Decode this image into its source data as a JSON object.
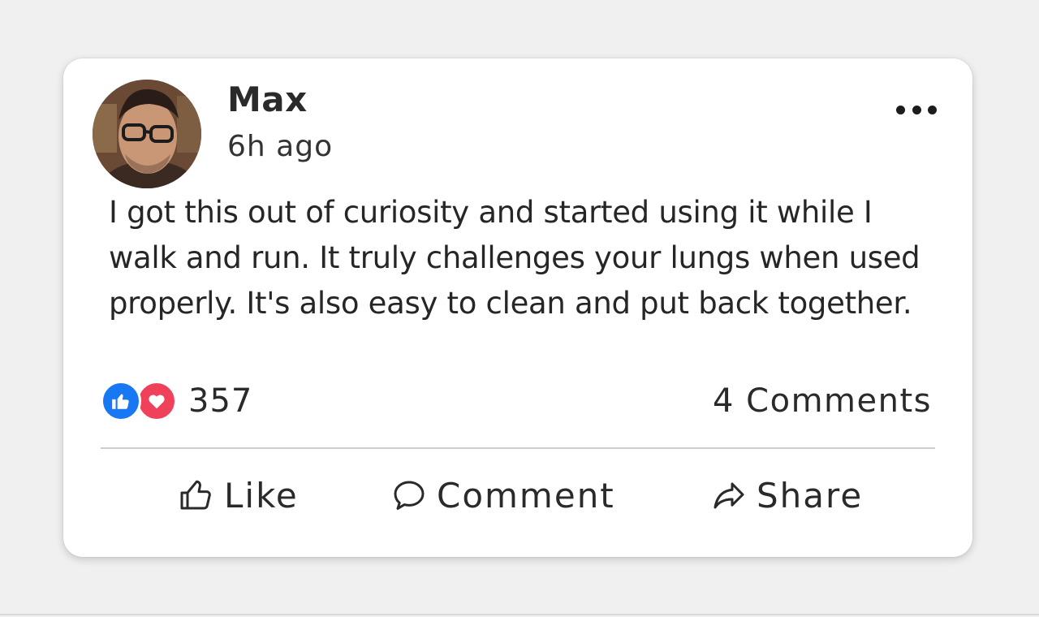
{
  "post": {
    "author": {
      "name": "Max",
      "avatar_icon": "profile-photo"
    },
    "time": "6h ago",
    "text": "I got this out of curiosity and started using it while I walk and run. It truly challenges your lungs when used properly. It's also easy to clean and put back together.",
    "more_icon": "more-horizontal-icon",
    "reactions": {
      "types": [
        "like",
        "love"
      ],
      "like_color": "#1877f2",
      "love_color": "#f0415a",
      "count": "357"
    },
    "comments_count_label": "4 Comments"
  },
  "actions": {
    "like": {
      "label": "Like",
      "icon": "thumbs-up-icon"
    },
    "comment": {
      "label": "Comment",
      "icon": "speech-bubble-icon"
    },
    "share": {
      "label": "Share",
      "icon": "share-arrow-icon"
    }
  }
}
